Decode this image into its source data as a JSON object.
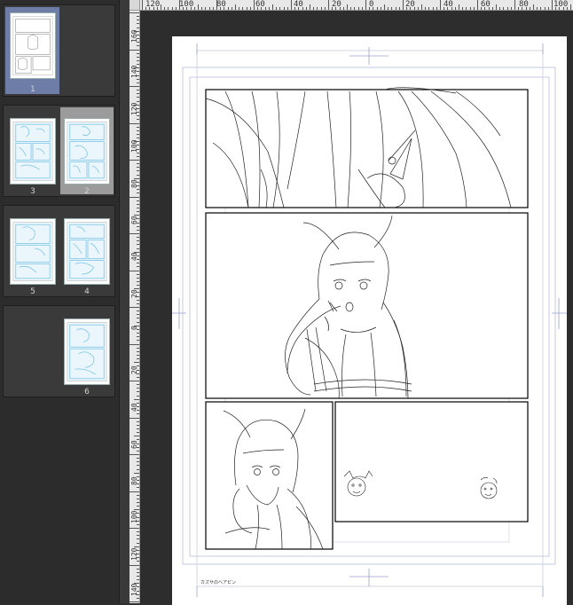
{
  "pages_panel": {
    "pages": [
      {
        "number": "1",
        "selected": true
      },
      {
        "number": "3"
      },
      {
        "number": "2",
        "hover": true
      },
      {
        "number": "5"
      },
      {
        "number": "4"
      },
      {
        "number": "6"
      }
    ]
  },
  "ruler_top": {
    "labels": [
      "120",
      "100",
      "80",
      "60",
      "40",
      "20",
      "0",
      "20",
      "40",
      "60",
      "80",
      "100"
    ]
  },
  "ruler_left": {
    "labels": [
      "160",
      "140",
      "120",
      "100",
      "80",
      "60",
      "40",
      "20",
      "0",
      "20",
      "40",
      "60",
      "80",
      "100",
      "120",
      "140"
    ]
  },
  "canvas": {
    "credit_text": "カズサのヘアピン"
  },
  "colors": {
    "accent_selected": "#6d7da7",
    "guide_blue": "#a8b0d8"
  }
}
